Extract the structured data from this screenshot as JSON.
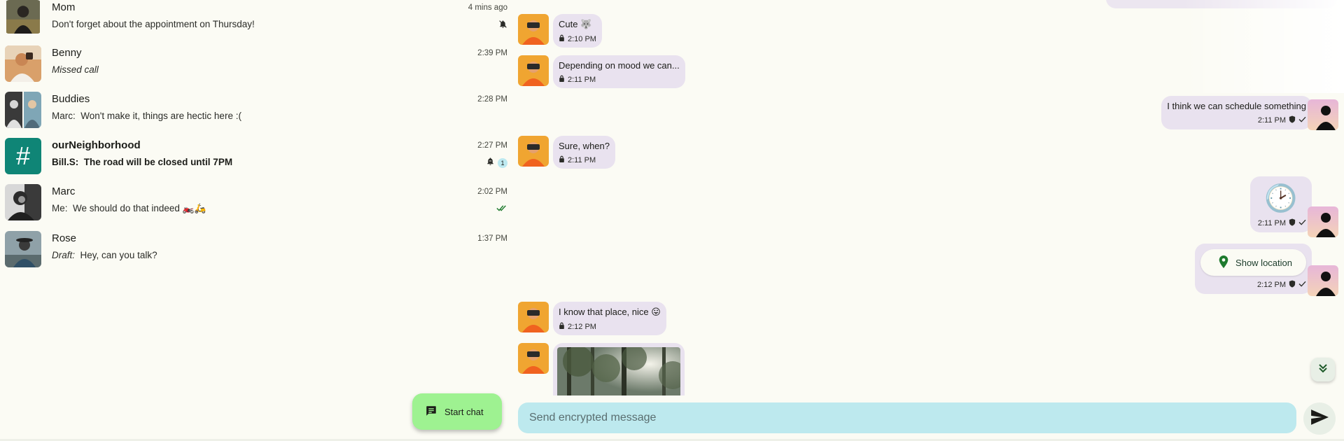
{
  "conversations": [
    {
      "name": "Mom",
      "preview": "Don't forget about the appointment on Thursday!",
      "time": "4 mins ago",
      "status": "muted"
    },
    {
      "name": "Benny",
      "preview": "Missed call",
      "time": "2:39 PM"
    },
    {
      "name": "Buddies",
      "sender": "Marc:",
      "preview": "Won't make it, things are hectic here :(",
      "time": "2:28 PM"
    },
    {
      "name": "ourNeighborhood",
      "sender": "Bill.S:",
      "preview": "The road will be closed until 7PM",
      "time": "2:27 PM",
      "unread": "1",
      "avatar_glyph": "#"
    },
    {
      "name": "Marc",
      "sender": "Me:",
      "preview": "We should do that indeed 🏍️🛵",
      "time": "2:02 PM",
      "status": "read"
    },
    {
      "name": "Rose",
      "sender": "Draft:",
      "preview": "Hey, can you talk?",
      "time": "1:37 PM"
    }
  ],
  "fab": {
    "label": "Start chat",
    "icon": "chat-icon"
  },
  "messages": [
    {
      "dir": "in",
      "text": "Cute 🐺",
      "time": "2:10 PM"
    },
    {
      "dir": "in",
      "text": "Depending on mood we can...",
      "time": "2:11 PM"
    },
    {
      "dir": "out",
      "text": "I think we can schedule something",
      "time": "2:11 PM"
    },
    {
      "dir": "in",
      "text": "Sure, when?",
      "time": "2:11 PM"
    },
    {
      "dir": "out",
      "emoji": "🕑",
      "time": "2:11 PM"
    },
    {
      "dir": "out",
      "button_label": "Show location",
      "time": "2:12 PM"
    },
    {
      "dir": "in",
      "text": "I know that place, nice 😛",
      "time": "2:12 PM"
    },
    {
      "dir": "in",
      "type": "image"
    }
  ],
  "composer": {
    "placeholder": "Send encrypted message"
  },
  "colors": {
    "background": "#fbfbf4",
    "bubble": "#e9e2ef",
    "composer": "#bde9ee",
    "fab": "#9ef291",
    "group_avatar": "#0f8576",
    "location_pin": "#1e7a2e"
  }
}
